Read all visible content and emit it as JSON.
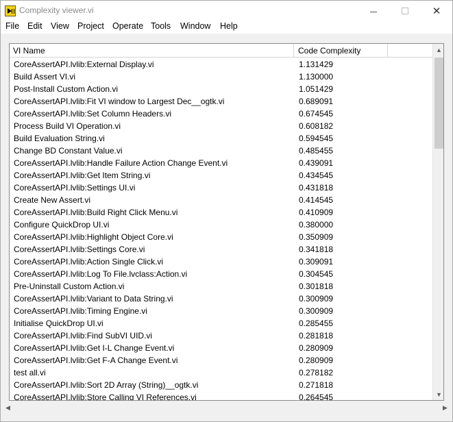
{
  "window": {
    "title": "Complexity viewer.vi",
    "controls": {
      "minimize": "—",
      "maximize": "□",
      "close": "✕"
    }
  },
  "menu": [
    "File",
    "Edit",
    "View",
    "Project",
    "Operate",
    "Tools",
    "Window",
    "Help"
  ],
  "table": {
    "columns": [
      "VI Name",
      "Code Complexity"
    ],
    "rows": [
      [
        "CoreAssertAPI.lvlib:External Display.vi",
        "1.131429"
      ],
      [
        "Build Assert VI.vi",
        "1.130000"
      ],
      [
        "Post-Install Custom Action.vi",
        "1.051429"
      ],
      [
        "CoreAssertAPI.lvlib:Fit VI window to Largest Dec__ogtk.vi",
        "0.689091"
      ],
      [
        "CoreAssertAPI.lvlib:Set Column Headers.vi",
        "0.674545"
      ],
      [
        "Process Build VI Operation.vi",
        "0.608182"
      ],
      [
        "Build Evaluation String.vi",
        "0.594545"
      ],
      [
        "Change BD Constant Value.vi",
        "0.485455"
      ],
      [
        "CoreAssertAPI.lvlib:Handle Failure Action Change Event.vi",
        "0.439091"
      ],
      [
        "CoreAssertAPI.lvlib:Get Item String.vi",
        "0.434545"
      ],
      [
        "CoreAssertAPI.lvlib:Settings UI.vi",
        "0.431818"
      ],
      [
        "Create New Assert.vi",
        "0.414545"
      ],
      [
        "CoreAssertAPI.lvlib:Build Right Click Menu.vi",
        "0.410909"
      ],
      [
        "Configure QuickDrop UI.vi",
        "0.380000"
      ],
      [
        "CoreAssertAPI.lvlib:Highlight Object Core.vi",
        "0.350909"
      ],
      [
        "CoreAssertAPI.lvlib:Settings Core.vi",
        "0.341818"
      ],
      [
        "CoreAssertAPI.lvlib:Action Single Click.vi",
        "0.309091"
      ],
      [
        "CoreAssertAPI.lvlib:Log To File.lvclass:Action.vi",
        "0.304545"
      ],
      [
        "Pre-Uninstall Custom Action.vi",
        "0.301818"
      ],
      [
        "CoreAssertAPI.lvlib:Variant to Data String.vi",
        "0.300909"
      ],
      [
        "CoreAssertAPI.lvlib:Timing Engine.vi",
        "0.300909"
      ],
      [
        "Initialise QuickDrop UI.vi",
        "0.285455"
      ],
      [
        "CoreAssertAPI.lvlib:Find SubVI UID.vi",
        "0.281818"
      ],
      [
        "CoreAssertAPI.lvlib:Get I-L Change Event.vi",
        "0.280909"
      ],
      [
        "CoreAssertAPI.lvlib:Get F-A Change Event.vi",
        "0.280909"
      ],
      [
        "test all.vi",
        "0.278182"
      ],
      [
        "CoreAssertAPI.lvlib:Sort 2D Array (String)__ogtk.vi",
        "0.271818"
      ],
      [
        "CoreAssertAPI.lvlib:Store Calling VI References.vi",
        "0.264545"
      ]
    ]
  },
  "scrollbars": {
    "up_arrow": "▲",
    "down_arrow": "▼",
    "left_arrow": "◀",
    "right_arrow": "▶"
  },
  "icons": {
    "app": "labview-vi-icon",
    "minimize": "minimize-icon",
    "maximize": "maximize-icon",
    "close": "close-icon"
  },
  "colors": {
    "title_text": "#8a8a8a",
    "app_icon": "#f5d21b",
    "window_bg": "#f0f0f0",
    "list_bg": "#ffffff"
  }
}
